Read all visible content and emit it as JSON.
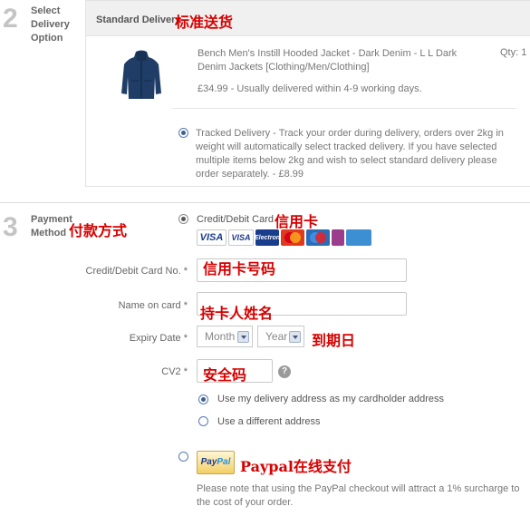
{
  "delivery": {
    "step_number": "2",
    "step_label": [
      "Select",
      "Delivery",
      "Option"
    ],
    "panel_title": "Standard Delivery",
    "panel_title_cn": "标准送货",
    "product": {
      "name": "Bench Men's Instill Hooded Jacket - Dark Denim - L L Dark Denim Jackets [Clothing/Men/Clothing]",
      "qty": "Qty: 1",
      "price_text": "£34.99 - Usually delivered within 4-9 working days."
    },
    "tracked_text": "Tracked Delivery - Track your order during delivery, orders over 2kg in weight will automatically select tracked delivery. If you have selected multiple items below 2kg and wish to select standard delivery please order separately. - £8.99"
  },
  "payment": {
    "step_number": "3",
    "step_label": [
      "Payment",
      "Method"
    ],
    "step_label_cn": "付款方式",
    "card_option_label": "Credit/Debit Card",
    "card_option_cn": "信用卡",
    "cards": [
      {
        "name": "VISA",
        "color": "#1a3c8c"
      },
      {
        "name": "VISA",
        "sub": "DEBIT",
        "color": "#1a3c8c"
      },
      {
        "name": "VISA",
        "sub": "Electron",
        "color": "#1a3c8c"
      },
      {
        "name": "MasterCard",
        "color": "#e03a1e"
      },
      {
        "name": "Maestro",
        "color": "#2b6cb7"
      },
      {
        "name": "Solo",
        "color": "#9b3c8c"
      },
      {
        "name": "AMEX",
        "color": "#3d8fd4"
      }
    ],
    "card_number_label": "Credit/Debit Card No. *",
    "card_number_cn": "信用卡号码",
    "name_label": "Name on card *",
    "name_cn": "持卡人姓名",
    "expiry_label": "Expiry Date *",
    "expiry_month": "Month",
    "expiry_year": "Year",
    "expiry_cn": "到期日",
    "cv2_label": "CV2 *",
    "cv2_cn": "安全码",
    "help_glyph": "?",
    "address_same": "Use my delivery address as my cardholder address",
    "address_different": "Use a different address",
    "paypal_logo_pay": "Pay",
    "paypal_logo_pal": "Pal",
    "paypal_cn": "Paypal在线支付",
    "paypal_note": "Please note that using the PayPal checkout will attract a 1% surcharge to the cost of your order."
  }
}
